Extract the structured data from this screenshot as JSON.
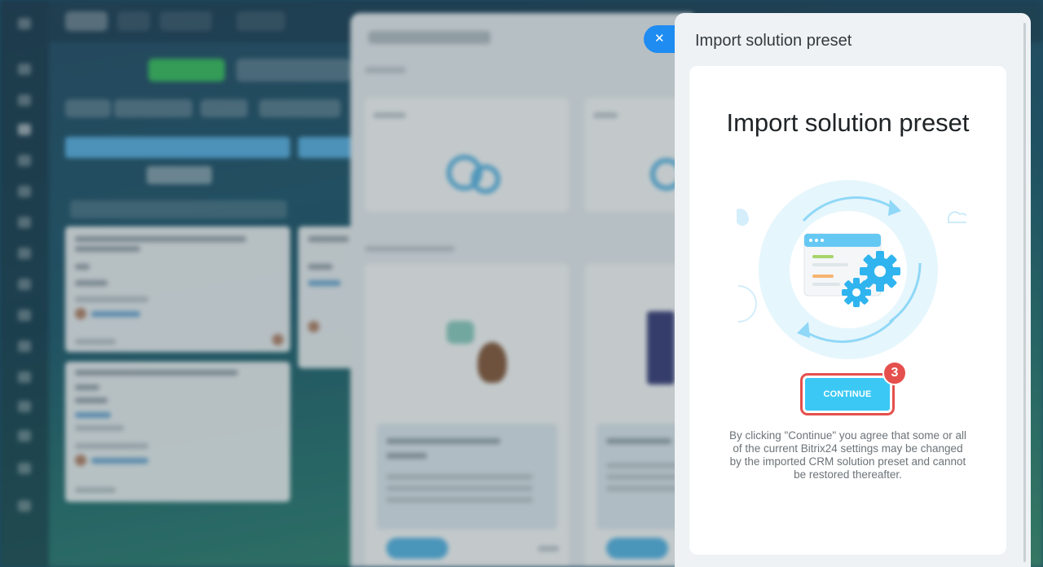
{
  "slider": {
    "title": "Import solution preset",
    "close_icon": "close-icon"
  },
  "card": {
    "heading": "Import solution preset",
    "illustration": "sync-gears-illustration",
    "continue_label": "CONTINUE",
    "step_badge": "3",
    "disclaimer": "By clicking \"Continue\" you agree that some or all of the current Bitrix24 settings may be changed by the imported CRM solution preset and cannot be restored thereafter."
  },
  "colors": {
    "continue_button": "#3bc8f5",
    "highlight": "#e5504c",
    "close_button": "#1f8cf2",
    "slider_bg": "#eef2f4"
  }
}
